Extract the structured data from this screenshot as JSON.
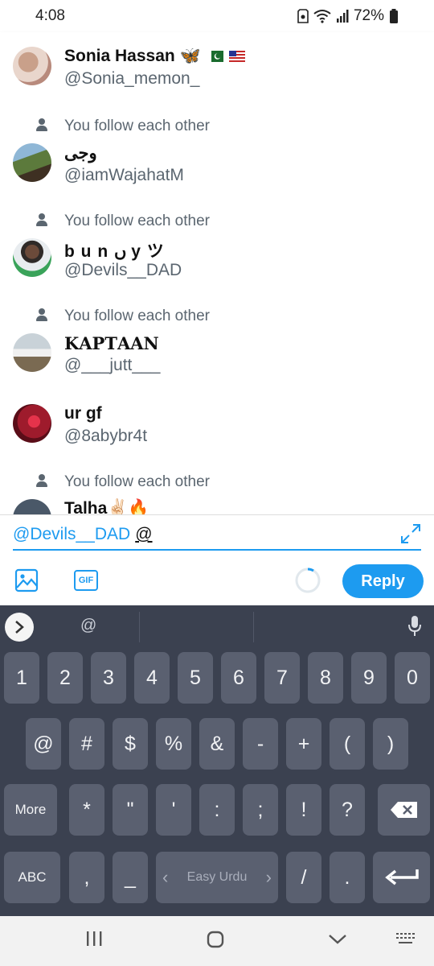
{
  "status_bar": {
    "time": "4:08",
    "battery": "72%"
  },
  "suggestions": [
    {
      "context": "",
      "name": "Sonia Hassan",
      "name_emoji": "🦋",
      "handle": "@Sonia_memon_"
    },
    {
      "context": "You follow each other",
      "name": "وجی",
      "handle": "@iamWajahatM"
    },
    {
      "context": "You follow each other",
      "name": "b u n ں y ツ",
      "handle": "@Devils__DAD"
    },
    {
      "context": "You follow each other",
      "name": "𝐊𝐀𝐏𝐓𝐀𝐀𝐍",
      "handle": "@___jutt___"
    },
    {
      "context": "",
      "name": "ur gf",
      "handle": "@8abybr4t"
    },
    {
      "context": "You follow each other",
      "name": "Talha✌🏻🔥",
      "handle": ""
    }
  ],
  "compose": {
    "mention": "@Devils__DAD",
    "typed": "@",
    "reply_label": "Reply",
    "gif_label": "GIF"
  },
  "keyboard": {
    "suggestion": "@",
    "row_numbers": [
      "1",
      "2",
      "3",
      "4",
      "5",
      "6",
      "7",
      "8",
      "9",
      "0"
    ],
    "row_symbols1": [
      "@",
      "#",
      "$",
      "%",
      "&",
      "-",
      "+",
      "(",
      ")"
    ],
    "row_symbols2": [
      "More",
      "*",
      "\"",
      "'",
      ":",
      ";",
      "!",
      "?"
    ],
    "row_bottom": {
      "abc": "ABC",
      "comma": ",",
      "underscore": "_",
      "space": "Easy Urdu",
      "slash": "/",
      "period": "."
    }
  },
  "colors": {
    "accent": "#1d9bf0",
    "keyboard_bg": "#3b4150",
    "key_bg": "#5a6070"
  }
}
